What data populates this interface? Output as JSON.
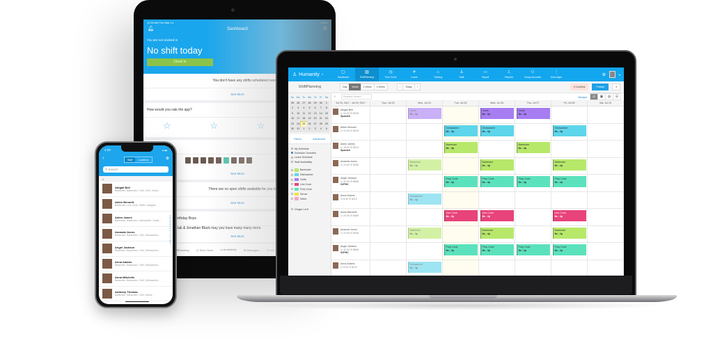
{
  "tablet": {
    "status_time": "11:04 AM  Thu Mar 14",
    "status_battery": "100%",
    "header_title": "Dashboard",
    "not_clocked_in": "You are not clocked in",
    "no_shift": "No shift today",
    "clock_in_label": "Clock In",
    "no_shifts_msg": "You don't have any shifts scheduled over the next 7 days",
    "see_more": "See More",
    "rate_question": "How would you rate the app?",
    "who_is_on_now": "Who is on now",
    "open_shifts_msg": "There are no open shifts available for you to pick over the next",
    "birthday_title": "Birthday Boys",
    "birthday_msg": "...lak & Jonathan Black may you have many many more.",
    "tabbar": [
      "ShiftPlanning",
      "Time Clock",
      "Availability",
      "Messages",
      "Lea..."
    ]
  },
  "laptop": {
    "brand": "Humanity",
    "nav_items": [
      {
        "label": "Dashboard",
        "icon": "dashboard-icon",
        "glyph": "▢"
      },
      {
        "label": "ShiftPlanning",
        "icon": "shiftplanning-icon",
        "glyph": "▥",
        "active": true
      },
      {
        "label": "Time Clock",
        "icon": "clock-icon",
        "glyph": "◷"
      },
      {
        "label": "Leave",
        "icon": "leave-icon",
        "glyph": "✈"
      },
      {
        "label": "Training",
        "icon": "training-icon",
        "glyph": "⌂"
      },
      {
        "label": "Staff",
        "icon": "staff-icon",
        "glyph": "♙"
      },
      {
        "label": "Payroll",
        "icon": "payroll-icon",
        "glyph": "▭"
      },
      {
        "label": "Reports",
        "icon": "reports-icon",
        "glyph": "⎍"
      },
      {
        "label": "Group Accounts",
        "icon": "group-icon",
        "glyph": "⚇"
      },
      {
        "label": "More Apps",
        "icon": "more-icon",
        "glyph": "⋮"
      }
    ],
    "toolbar": {
      "section_title": "ShiftPlanning",
      "views": [
        "Day",
        "Week",
        "2 Week",
        "4 Week"
      ],
      "active_view": "Week",
      "prev": "‹",
      "today": "Today",
      "next": "›",
      "conflicts": "0 Conflicts",
      "publish": "Publish",
      "more": "▾"
    },
    "calendar": {
      "weekdays": [
        "Su",
        "Mo",
        "Tu",
        "We",
        "Th",
        "Fr",
        "Sa"
      ],
      "weeks": [
        [
          "25",
          "26",
          "27",
          "28",
          "29",
          "30",
          "1"
        ],
        [
          "2",
          "3",
          "4",
          "5",
          "6",
          "7",
          "8"
        ],
        [
          "9",
          "10",
          "11",
          "12",
          "13",
          "14",
          "15"
        ],
        [
          "16",
          "17",
          "18",
          "19",
          "20",
          "21",
          "22"
        ],
        [
          "23",
          "24",
          "25",
          "26",
          "27",
          "28",
          "29"
        ],
        [
          "30",
          "31",
          "1",
          "2",
          "3",
          "4",
          "5"
        ]
      ],
      "today_week": 4,
      "today_index": 2
    },
    "filters": {
      "tab1": "Filters",
      "tab2": "Advanced"
    },
    "schedule_views": [
      {
        "label": "My Schedule",
        "selected": false
      },
      {
        "label": "Schedule Overview",
        "selected": true
      },
      {
        "label": "Leave Schedule",
        "selected": false
      },
      {
        "label": "Staff Availability",
        "selected": false
      }
    ],
    "roles": [
      {
        "label": "Bartender",
        "color": "#b7e86a"
      },
      {
        "label": "Dishwasher",
        "color": "#5dd5ea"
      },
      {
        "label": "Hosts",
        "color": "#a77df2"
      },
      {
        "label": "Line Cook",
        "color": "#e8437a"
      },
      {
        "label": "Prep Cook",
        "color": "#5be2bd"
      },
      {
        "label": "Server",
        "color": "#f7e22f"
      },
      {
        "label": "Setter",
        "color": "#f7a7c7"
      }
    ],
    "location": "Ginger LA ▾",
    "search_placeholder": "Schedule Search",
    "budget": "Budget",
    "date_range": "Jul 23, 2017 - Jul 29, 2017",
    "days": [
      "Sun, Jul 23",
      "Mon, Jul 24",
      "Tue, Jul 25",
      "Wed, Jul 26",
      "Thu, Jul 27",
      "Fri, Jul 28",
      "Sat, Jul 29"
    ],
    "today_col": 2,
    "employees": [
      {
        "name": "Abigail Bell",
        "meta": "◷ 24.00  ⊟ $336",
        "tag": "Spanish",
        "shifts": [
          null,
          {
            "role": "Hosts",
            "time": "8a - 4p",
            "color": "#a77df2",
            "light": true
          },
          null,
          {
            "role": "Hosts",
            "time": "8a - 4p",
            "color": "#a77df2"
          },
          {
            "role": "Hosts",
            "time": "8a - 4p",
            "color": "#a77df2"
          },
          null,
          null
        ]
      },
      {
        "name": "Aiden Bennett",
        "meta": "◷ 24.00  ⊟ $240",
        "tag": "",
        "shifts": [
          null,
          null,
          {
            "role": "Dishwasher",
            "time": "8a - 4p",
            "color": "#5dd5ea"
          },
          {
            "role": "Dishwasher",
            "time": "8a - 4p",
            "color": "#5dd5ea"
          },
          null,
          {
            "role": "Dishwasher",
            "time": "8a - 4p",
            "color": "#5dd5ea"
          },
          null
        ]
      },
      {
        "name": "Aiden James",
        "meta": "◷ 16.00  ⊟ $224",
        "tag": "Spanish",
        "shifts": [
          null,
          null,
          {
            "role": "Bartender",
            "time": "8a - 4p",
            "color": "#b7e86a"
          },
          null,
          {
            "role": "Bartender",
            "time": "8a - 4p",
            "color": "#b7e86a"
          },
          null,
          null
        ]
      },
      {
        "name": "Amanda Joens",
        "meta": "◷ 24.00  ⊟ $336",
        "tag": "",
        "shifts": [
          null,
          {
            "role": "Bartender",
            "time": "8a - 4p",
            "color": "#b7e86a",
            "light": true
          },
          null,
          {
            "role": "Bartender",
            "time": "8a - 4p",
            "color": "#b7e86a"
          },
          null,
          {
            "role": "Bartender",
            "time": "8a - 4p",
            "color": "#b7e86a"
          },
          null
        ]
      },
      {
        "name": "Angel Jackson",
        "meta": "◷ 32.00  ⊟ $896",
        "tag": "SJFHC",
        "shifts": [
          null,
          null,
          {
            "role": "Prep Cook",
            "time": "8a - 4p",
            "color": "#5be2bd"
          },
          {
            "role": "Prep Cook",
            "time": "8a - 4p",
            "color": "#5be2bd"
          },
          {
            "role": "Prep Cook",
            "time": "8a - 4p",
            "color": "#5be2bd"
          },
          {
            "role": "Prep Cook",
            "time": "8a - 4p",
            "color": "#5be2bd"
          },
          null
        ]
      },
      {
        "name": "Anna Adams",
        "meta": "◷ 8.00  ⊟ $112",
        "tag": "",
        "shifts": [
          null,
          {
            "role": "Dishwasher",
            "time": "8a - 4p",
            "color": "#5dd5ea",
            "light": true
          },
          null,
          null,
          null,
          null,
          null
        ]
      },
      {
        "name": "Anna Mitchelle",
        "meta": "◷ 24.00  ⊟ $480",
        "tag": "",
        "shifts": [
          null,
          null,
          {
            "role": "Line Cook",
            "time": "8a - 4p",
            "color": "#e8437a"
          },
          {
            "role": "Line Cook",
            "time": "8a - 4p",
            "color": "#e8437a"
          },
          null,
          {
            "role": "Line Cook",
            "time": "8a - 4p",
            "color": "#e8437a"
          },
          null
        ]
      },
      {
        "name": "Amanda Joens",
        "meta": "◷ 24.00  ⊟ $336",
        "tag": "",
        "shifts": [
          null,
          {
            "role": "Bartender",
            "time": "8a - 4p",
            "color": "#b7e86a",
            "light": true
          },
          null,
          {
            "role": "Bartender",
            "time": "8a - 4p",
            "color": "#b7e86a"
          },
          null,
          {
            "role": "Bartender",
            "time": "8a - 4p",
            "color": "#b7e86a"
          },
          null
        ]
      },
      {
        "name": "Angel Jackson",
        "meta": "◷ 32.00  ⊟ $896",
        "tag": "SJFHC",
        "shifts": [
          null,
          null,
          {
            "role": "Prep Cook",
            "time": "8a - 4p",
            "color": "#5be2bd"
          },
          {
            "role": "Prep Cook",
            "time": "8a - 4p",
            "color": "#5be2bd"
          },
          {
            "role": "Prep Cook",
            "time": "8a - 4p",
            "color": "#5be2bd"
          },
          {
            "role": "Prep Cook",
            "time": "8a - 4p",
            "color": "#5be2bd"
          },
          null
        ]
      },
      {
        "name": "Anna Adams",
        "meta": "◷ 8.00  ⊟ $112",
        "tag": "",
        "shifts": [
          null,
          {
            "role": "Dishwasher",
            "time": "8a - 4p",
            "color": "#5dd5ea",
            "light": true
          },
          null,
          null,
          null,
          null,
          null
        ]
      }
    ]
  },
  "phone": {
    "time": "4:29",
    "signal": "▴ ▬",
    "segments": [
      "Staff",
      "Locations"
    ],
    "active_segment": "Staff",
    "search_placeholder": "Search",
    "section": "A",
    "index_letters": [
      "A",
      "B",
      "C",
      "D",
      "E",
      "F",
      "G",
      "H",
      "I",
      "J",
      "K",
      "L",
      "M",
      "N"
    ],
    "contacts": [
      {
        "name": "Abigail Bell",
        "roles": "Bartender, Bartender, Chef, Chef, Hosts,..."
      },
      {
        "name": "Aiden Bennett",
        "roles": "Bartender, Line Cook, Setter, designer"
      },
      {
        "name": "Aiden James",
        "roles": "Bartender, Bartender, Dishwasher, Hosts,..."
      },
      {
        "name": "Amanda Joens",
        "roles": "Bartender, Bartender, Chef, Dishwasher,..."
      },
      {
        "name": "Angel Jackson",
        "roles": "Bartender, Bartender, Chef, Dishwasher,..."
      },
      {
        "name": "Anna Adams",
        "roles": "Bartender, Bartender, Chef, Dishwasher,..."
      },
      {
        "name": "Anna Mitchelle",
        "roles": "Bartender, Bartender, Chef, Dishwasher,..."
      },
      {
        "name": "Anthony Thomas",
        "roles": "Bartender, Bartender, Chef, Dishw..."
      }
    ]
  }
}
